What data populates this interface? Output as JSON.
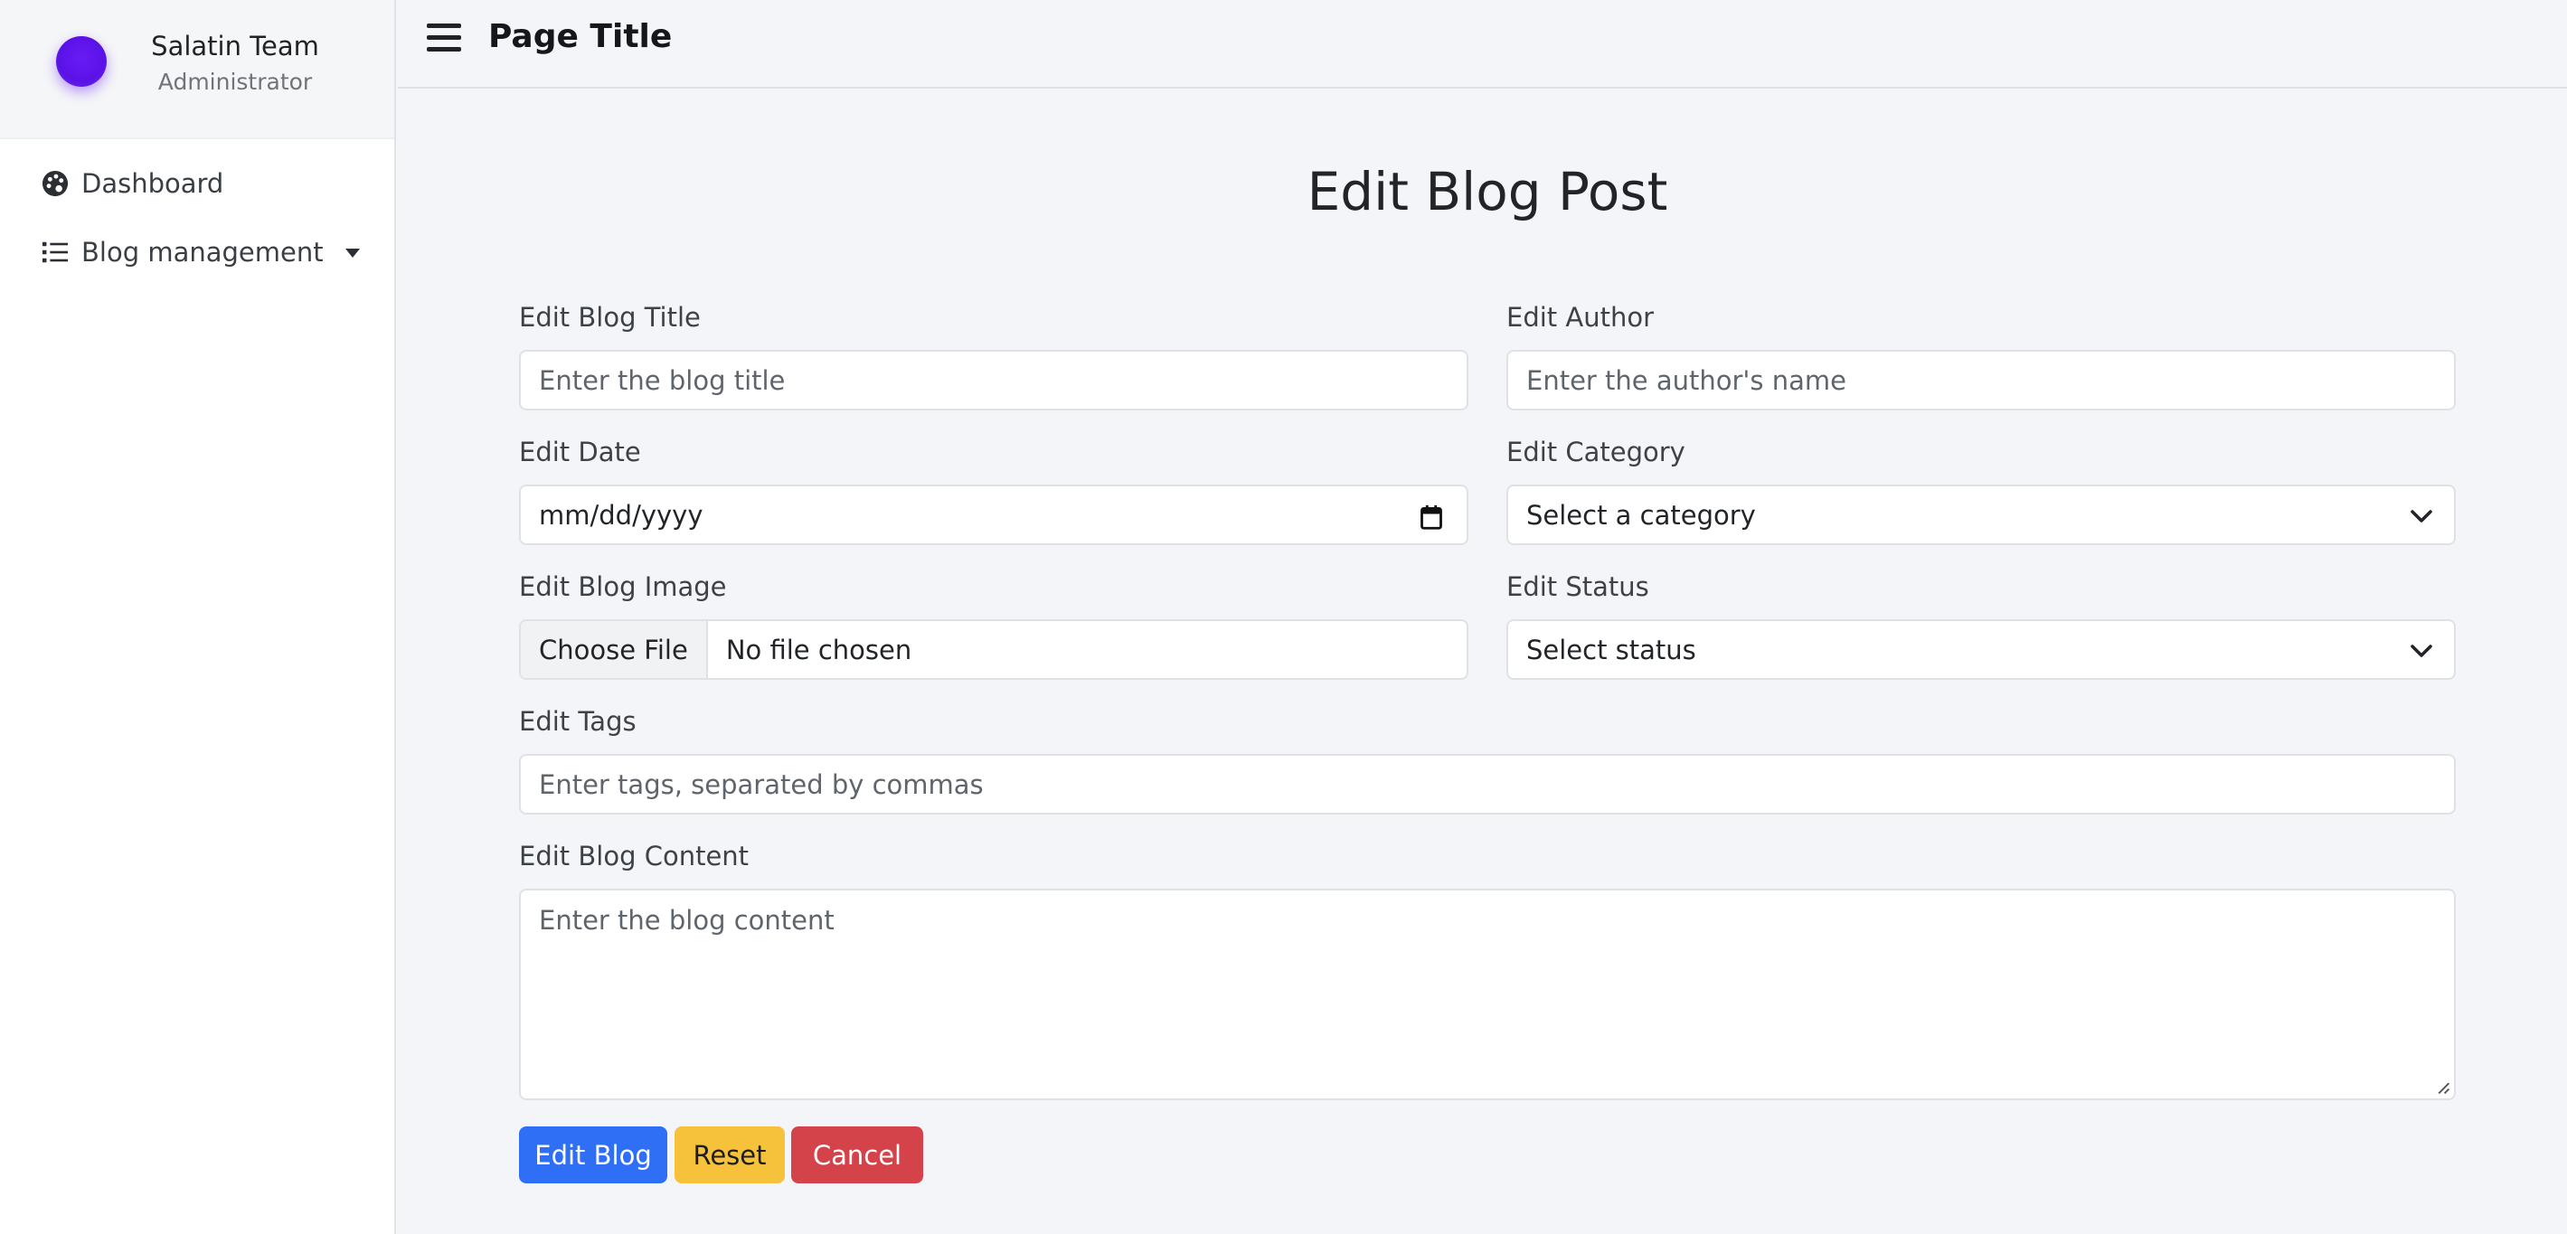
{
  "sidebar": {
    "profile": {
      "name": "Salatin Team",
      "role": "Administrator"
    },
    "items": [
      {
        "label": "Dashboard",
        "icon": "palette-icon"
      },
      {
        "label": "Blog management",
        "icon": "list-icon",
        "has_dropdown": true
      }
    ]
  },
  "header": {
    "title": "Page Title"
  },
  "form": {
    "heading": "Edit Blog Post",
    "title_label": "Edit Blog Title",
    "title_placeholder": "Enter the blog title",
    "author_label": "Edit Author",
    "author_placeholder": "Enter the author's name",
    "date_label": "Edit Date",
    "date_value": "mm/dd/yyyy",
    "category_label": "Edit Category",
    "category_value": "Select a category",
    "image_label": "Edit Blog Image",
    "file_button": "Choose File",
    "file_status": "No file chosen",
    "status_label": "Edit Status",
    "status_value": "Select status",
    "tags_label": "Edit Tags",
    "tags_placeholder": "Enter tags, separated by commas",
    "content_label": "Edit Blog Content",
    "content_placeholder": "Enter the blog content"
  },
  "buttons": {
    "submit": "Edit Blog",
    "reset": "Reset",
    "cancel": "Cancel"
  },
  "colors": {
    "primary": "#2e6ff6",
    "warning": "#f7c23b",
    "danger": "#d5434a",
    "avatar": "#5a12e6"
  }
}
